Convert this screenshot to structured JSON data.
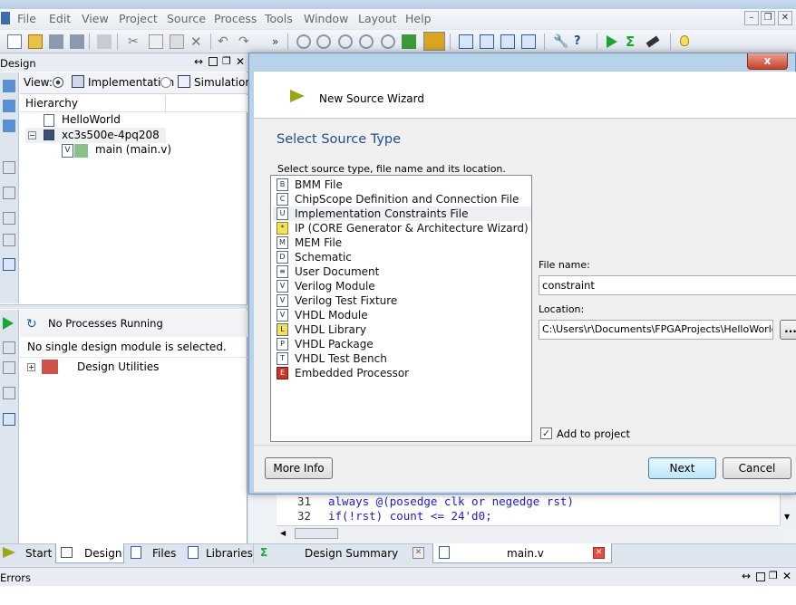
{
  "menu": [
    "File",
    "Edit",
    "View",
    "Project",
    "Source",
    "Process",
    "Tools",
    "Window",
    "Layout",
    "Help"
  ],
  "design_panel": {
    "title": "Design",
    "view_label": "View:",
    "view_options": [
      "Implementation",
      "Simulation"
    ],
    "hierarchy_label": "Hierarchy",
    "tree": [
      {
        "label": "HelloWorld"
      },
      {
        "label": "xc3s500e-4pq208"
      },
      {
        "label": "main (main.v)"
      }
    ]
  },
  "processes": {
    "status": "No Processes Running",
    "message": "No single design module is selected.",
    "item": "Design Utilities"
  },
  "bottom_tabs": [
    "Start",
    "Design",
    "Files",
    "Libraries"
  ],
  "editor_tabs": [
    {
      "label": "Design Summary"
    },
    {
      "label": "main.v"
    }
  ],
  "code_lines": [
    {
      "num": "31",
      "text": "always @(posedge clk or negedge rst)"
    },
    {
      "num": "32",
      "text": "  if(!rst) count <= 24'd0;"
    }
  ],
  "errors_panel": {
    "title": "Errors"
  },
  "dialog": {
    "title": "New Source Wizard",
    "heading": "Select Source Type",
    "instruction": "Select source type, file name and its location.",
    "source_types": [
      {
        "label": "BMM File",
        "icon": "bmm-file-icon",
        "glyph": "B"
      },
      {
        "label": "ChipScope Definition and Connection File",
        "icon": "chipscope-icon",
        "glyph": "C"
      },
      {
        "label": "Implementation Constraints File",
        "icon": "constraints-file-icon",
        "glyph": "U"
      },
      {
        "label": "IP (CORE Generator & Architecture Wizard)",
        "icon": "ip-core-icon",
        "glyph": "*"
      },
      {
        "label": "MEM File",
        "icon": "mem-file-icon",
        "glyph": "M"
      },
      {
        "label": "Schematic",
        "icon": "schematic-icon",
        "glyph": "D"
      },
      {
        "label": "User Document",
        "icon": "user-document-icon",
        "glyph": "≡"
      },
      {
        "label": "Verilog Module",
        "icon": "verilog-module-icon",
        "glyph": "V"
      },
      {
        "label": "Verilog Test Fixture",
        "icon": "verilog-test-fixture-icon",
        "glyph": "V"
      },
      {
        "label": "VHDL Module",
        "icon": "vhdl-module-icon",
        "glyph": "V"
      },
      {
        "label": "VHDL Library",
        "icon": "vhdl-library-icon",
        "glyph": "L"
      },
      {
        "label": "VHDL Package",
        "icon": "vhdl-package-icon",
        "glyph": "P"
      },
      {
        "label": "VHDL Test Bench",
        "icon": "vhdl-test-bench-icon",
        "glyph": "T"
      },
      {
        "label": "Embedded Processor",
        "icon": "embedded-processor-icon",
        "glyph": "E"
      }
    ],
    "selected_index": 2,
    "file_name_label": "File name:",
    "file_name_value": "constraint",
    "location_label": "Location:",
    "location_value": "C:\\Users\\r\\Documents\\FPGAProjects\\HelloWorld",
    "browse_label": "...",
    "add_to_project_label": "Add to project",
    "add_to_project_checked": true,
    "more_info_label": "More Info",
    "next_label": "Next",
    "cancel_label": "Cancel",
    "close_label": "x"
  },
  "colors": {
    "accent": "#1f5fa8",
    "heading": "#1e4f8f",
    "keyword": "#1c1cd6",
    "selection": "#eef0f3"
  }
}
